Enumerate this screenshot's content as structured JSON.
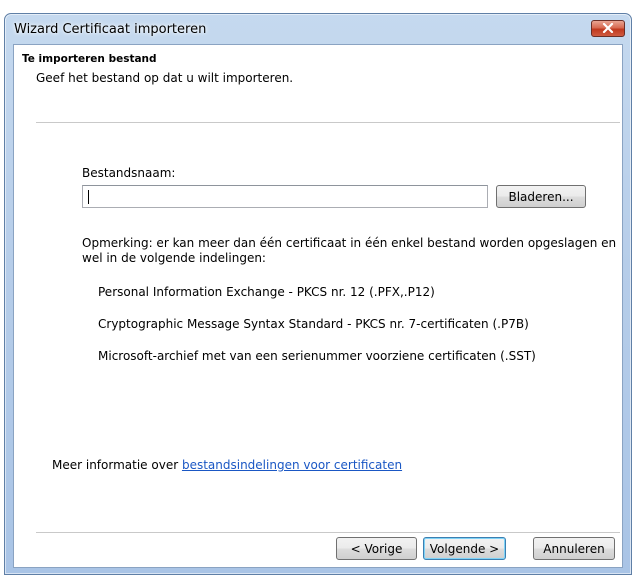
{
  "window": {
    "title": "Wizard Certificaat importeren"
  },
  "header": {
    "title": "Te importeren bestand",
    "subtitle": "Geef het bestand op dat u wilt importeren."
  },
  "form": {
    "filename_label": "Bestandsnaam:",
    "filename_value": "",
    "browse_label": "Bladeren..."
  },
  "note": {
    "line1": "Opmerking: er kan meer dan één certificaat in één enkel bestand worden opgeslagen en",
    "line2": "wel in de volgende indelingen:"
  },
  "formats": [
    "Personal Information Exchange - PKCS nr. 12 (.PFX,.P12)",
    "Cryptographic Message Syntax Standard - PKCS nr. 7-certificaten (.P7B)",
    "Microsoft-archief met van een serienummer voorziene certificaten (.SST)"
  ],
  "more_info": {
    "prefix": "Meer informatie over ",
    "link": "bestandsindelingen voor certificaten"
  },
  "buttons": {
    "back": "< Vorige",
    "next": "Volgende >",
    "cancel": "Annuleren"
  },
  "icons": {
    "close": "close-icon"
  },
  "colors": {
    "link": "#1a57c4",
    "close_button": "#c8452c",
    "titlebar": "#b6cde9"
  }
}
